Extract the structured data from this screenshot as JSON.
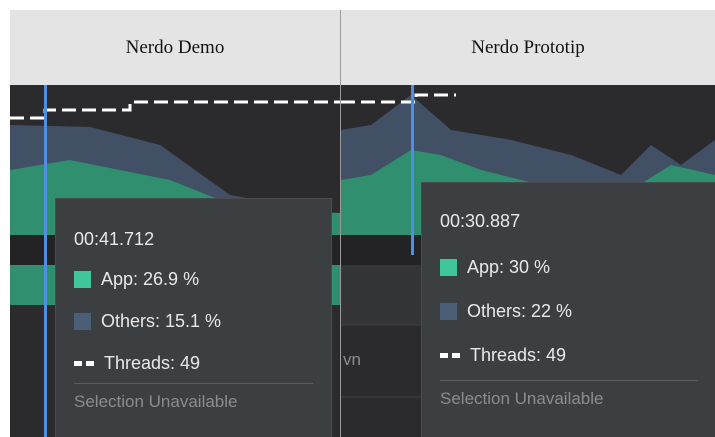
{
  "colors": {
    "app": "#3ec79a",
    "others": "#4b5e78",
    "threads": "#ffffff",
    "cursor": "#4e8fe3",
    "header_bg": "#e4e4e4",
    "panel_bg": "#2b2b2d",
    "tooltip_bg": "#3c3f41"
  },
  "panels": [
    {
      "title": "Nerdo Demo",
      "tooltip": {
        "time": "00:41.712",
        "app": "App: 26.9 %",
        "others": "Others: 15.1 %",
        "threads": "Threads: 49",
        "selection": "Selection Unavailable"
      }
    },
    {
      "title": "Nerdo Prototip",
      "background_label": "vn",
      "tooltip": {
        "time": "00:30.887",
        "app": "App: 30 %",
        "others": "Others: 22 %",
        "threads": "Threads: 49",
        "selection": "Selection Unavailable"
      }
    }
  ]
}
